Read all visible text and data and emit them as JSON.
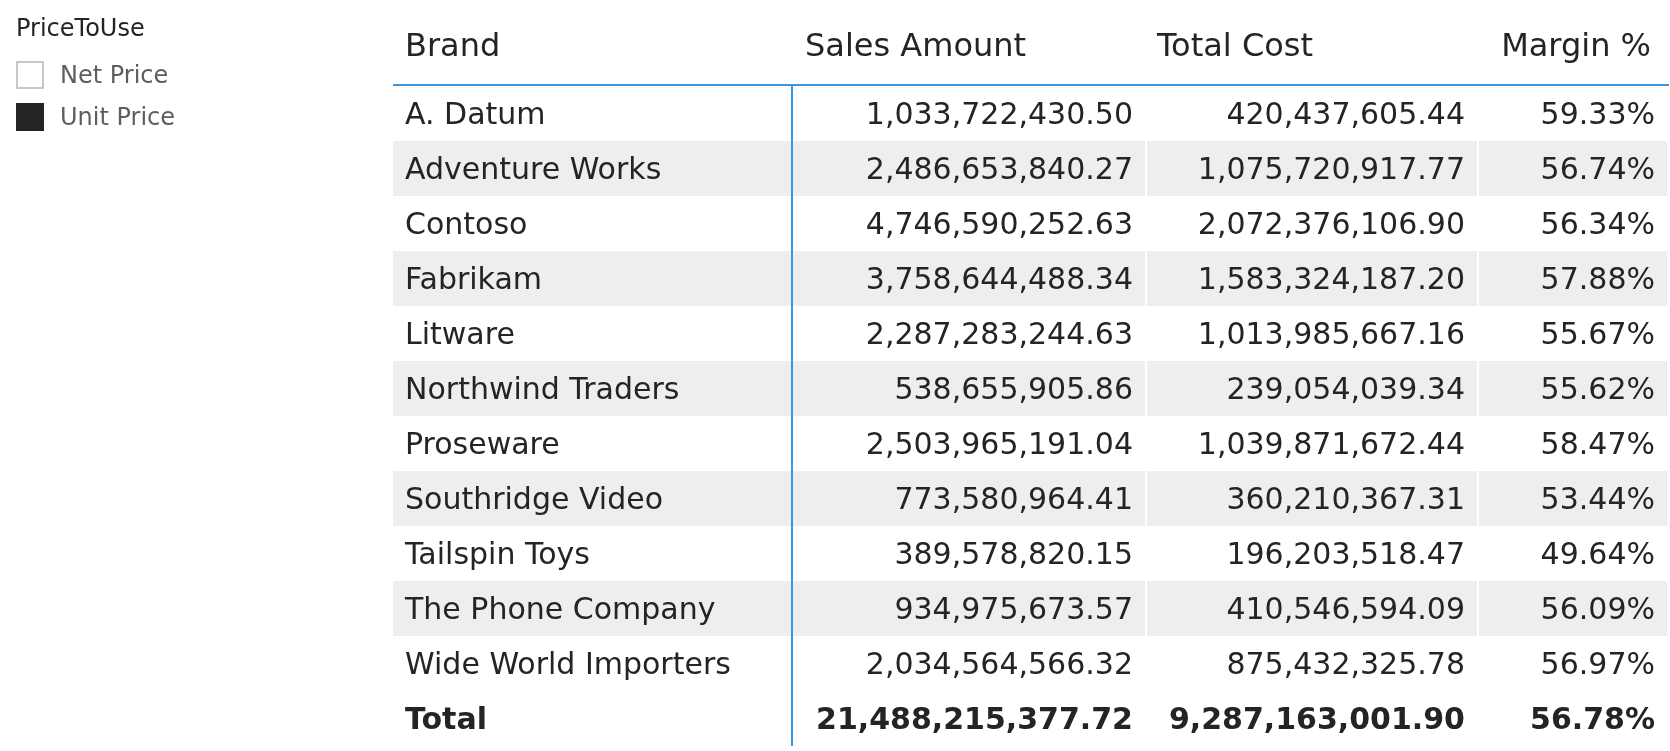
{
  "slicer": {
    "title": "PriceToUse",
    "items": [
      {
        "label": "Net Price",
        "selected": false
      },
      {
        "label": "Unit Price",
        "selected": true
      }
    ]
  },
  "table": {
    "columns": [
      "Brand",
      "Sales Amount",
      "Total Cost",
      "Margin %"
    ],
    "rows": [
      [
        "A. Datum",
        "1,033,722,430.50",
        "420,437,605.44",
        "59.33%"
      ],
      [
        "Adventure Works",
        "2,486,653,840.27",
        "1,075,720,917.77",
        "56.74%"
      ],
      [
        "Contoso",
        "4,746,590,252.63",
        "2,072,376,106.90",
        "56.34%"
      ],
      [
        "Fabrikam",
        "3,758,644,488.34",
        "1,583,324,187.20",
        "57.88%"
      ],
      [
        "Litware",
        "2,287,283,244.63",
        "1,013,985,667.16",
        "55.67%"
      ],
      [
        "Northwind Traders",
        "538,655,905.86",
        "239,054,039.34",
        "55.62%"
      ],
      [
        "Proseware",
        "2,503,965,191.04",
        "1,039,871,672.44",
        "58.47%"
      ],
      [
        "Southridge Video",
        "773,580,964.41",
        "360,210,367.31",
        "53.44%"
      ],
      [
        "Tailspin Toys",
        "389,578,820.15",
        "196,203,518.47",
        "49.64%"
      ],
      [
        "The Phone Company",
        "934,975,673.57",
        "410,546,594.09",
        "56.09%"
      ],
      [
        "Wide World Importers",
        "2,034,564,566.32",
        "875,432,325.78",
        "56.97%"
      ]
    ],
    "total": [
      "Total",
      "21,488,215,377.72",
      "9,287,163,001.90",
      "56.78%"
    ]
  }
}
